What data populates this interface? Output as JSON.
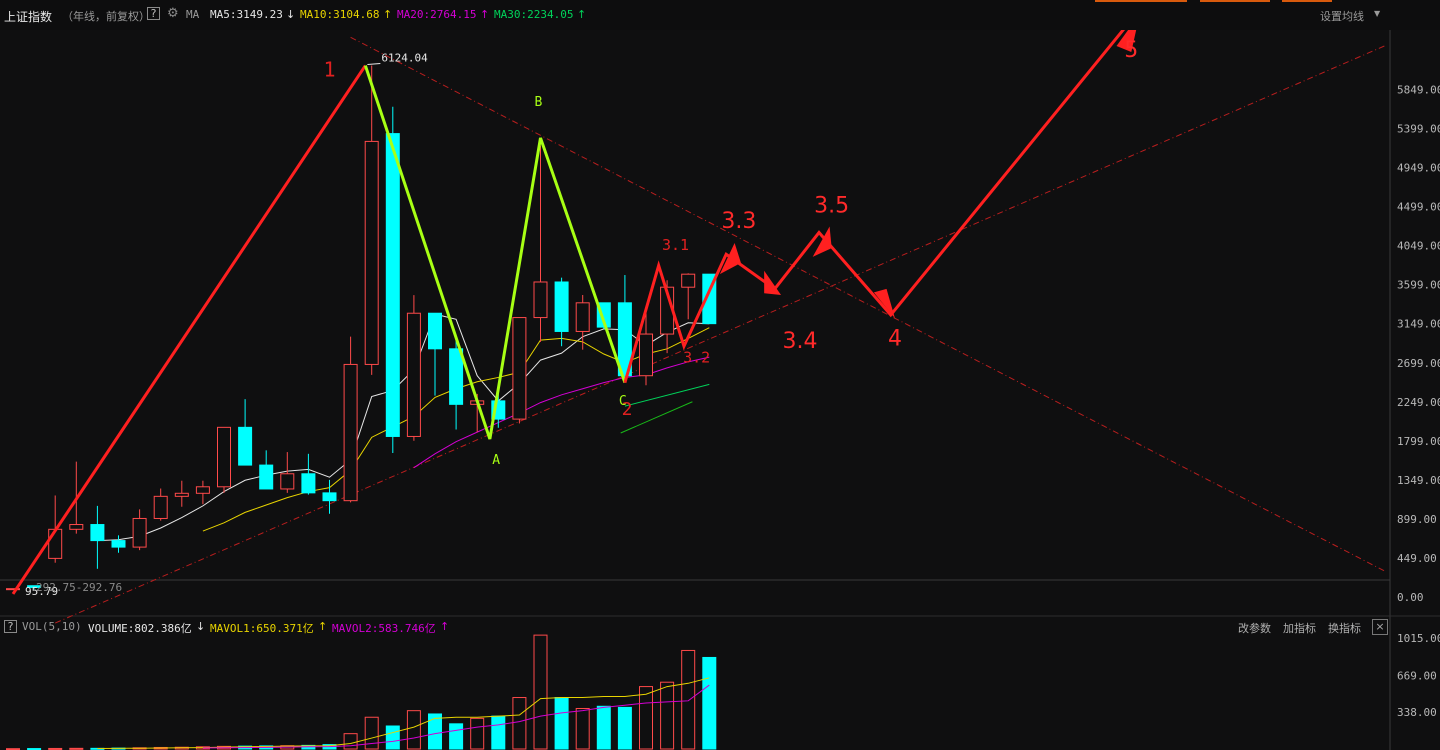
{
  "header": {
    "title": "上证指数",
    "subtitle": "（年线，前复权）",
    "help": "?",
    "gear_icon": "gear-icon",
    "ma_label": "MA",
    "ma5": "MA5:3149.23",
    "ma5_arrow": "↓",
    "ma10": "MA10:3104.68",
    "ma10_arrow": "↑",
    "ma20": "MA20:2764.15",
    "ma20_arrow": "↑",
    "ma30": "MA30:2234.05",
    "ma30_arrow": "↑",
    "settings": "设置均线",
    "colors": {
      "ma5": "#e6e6e6",
      "ma10": "#e8d400",
      "ma20": "#d400d4",
      "ma30": "#00d25a"
    }
  },
  "volume_panel": {
    "label": "VOL(5,10)",
    "volume": "VOLUME:802.386亿",
    "volume_arrow": "↓",
    "mavol1": "MAVOL1:650.371亿",
    "mavol1_arrow": "↑",
    "mavol2": "MAVOL2:583.746亿",
    "mavol2_arrow": "↑",
    "btn_change_params": "改参数",
    "btn_add_indicator": "加指标",
    "btn_switch_indicator": "换指标",
    "close": "×"
  },
  "chart_data": {
    "type": "candlestick",
    "price_axis": {
      "ticks": [
        "5849.00",
        "5399.00",
        "4949.00",
        "4499.00",
        "4049.00",
        "3599.00",
        "3149.00",
        "2699.00",
        "2249.00",
        "1799.00",
        "1349.00",
        "899.00",
        "449.00",
        "0.00"
      ],
      "ylim": [
        0,
        6400
      ]
    },
    "volume_axis": {
      "ticks": [
        "1015.00",
        "669.00",
        "338.00"
      ],
      "ylim": [
        0,
        1150
      ]
    },
    "candles": [
      {
        "o": 96,
        "h": 96,
        "l": 96,
        "c": 96,
        "v": 3
      },
      {
        "o": 130,
        "h": 130,
        "l": 95,
        "c": 110,
        "v": 4
      },
      {
        "o": 445,
        "h": 1170,
        "l": 395,
        "c": 780,
        "v": 5
      },
      {
        "o": 780,
        "h": 1560,
        "l": 730,
        "c": 835,
        "v": 6
      },
      {
        "o": 835,
        "h": 1050,
        "l": 325,
        "c": 650,
        "v": 6
      },
      {
        "o": 650,
        "h": 710,
        "l": 510,
        "c": 575,
        "v": 8
      },
      {
        "o": 575,
        "h": 1010,
        "l": 540,
        "c": 905,
        "v": 11
      },
      {
        "o": 905,
        "h": 1250,
        "l": 880,
        "c": 1160,
        "v": 14
      },
      {
        "o": 1160,
        "h": 1340,
        "l": 1040,
        "c": 1195,
        "v": 16
      },
      {
        "o": 1195,
        "h": 1340,
        "l": 1070,
        "c": 1270,
        "v": 20
      },
      {
        "o": 1270,
        "h": 1800,
        "l": 1200,
        "c": 1955,
        "v": 24
      },
      {
        "o": 1955,
        "h": 2280,
        "l": 1570,
        "c": 1520,
        "v": 26
      },
      {
        "o": 1520,
        "h": 1690,
        "l": 1380,
        "c": 1245,
        "v": 28
      },
      {
        "o": 1245,
        "h": 1670,
        "l": 1200,
        "c": 1420,
        "v": 30
      },
      {
        "o": 1420,
        "h": 1650,
        "l": 1180,
        "c": 1200,
        "v": 33
      },
      {
        "o": 1200,
        "h": 1350,
        "l": 960,
        "c": 1110,
        "v": 40
      },
      {
        "o": 1110,
        "h": 3000,
        "l": 1090,
        "c": 2680,
        "v": 140
      },
      {
        "o": 2680,
        "h": 6124,
        "l": 2560,
        "c": 5250,
        "v": 290
      },
      {
        "o": 5340,
        "h": 5650,
        "l": 1660,
        "c": 1850,
        "v": 210
      },
      {
        "o": 1850,
        "h": 3478,
        "l": 1800,
        "c": 3270,
        "v": 350
      },
      {
        "o": 3270,
        "h": 3260,
        "l": 2320,
        "c": 2860,
        "v": 320
      },
      {
        "o": 2860,
        "h": 3000,
        "l": 1930,
        "c": 2220,
        "v": 230
      },
      {
        "o": 2220,
        "h": 2340,
        "l": 1900,
        "c": 2260,
        "v": 280
      },
      {
        "o": 2260,
        "h": 2450,
        "l": 1950,
        "c": 2050,
        "v": 300
      },
      {
        "o": 2050,
        "h": 3200,
        "l": 2000,
        "c": 3220,
        "v": 470
      },
      {
        "o": 3220,
        "h": 5200,
        "l": 2940,
        "c": 3630,
        "v": 1040
      },
      {
        "o": 3630,
        "h": 3680,
        "l": 2890,
        "c": 3060,
        "v": 470
      },
      {
        "o": 3060,
        "h": 3480,
        "l": 2850,
        "c": 3390,
        "v": 370
      },
      {
        "o": 3390,
        "h": 3390,
        "l": 3090,
        "c": 3110,
        "v": 390
      },
      {
        "o": 3390,
        "h": 3710,
        "l": 2490,
        "c": 2550,
        "v": 380
      },
      {
        "o": 2550,
        "h": 3340,
        "l": 2440,
        "c": 3030,
        "v": 570
      },
      {
        "o": 3030,
        "h": 3650,
        "l": 2810,
        "c": 3570,
        "v": 610
      },
      {
        "o": 3570,
        "h": 3730,
        "l": 3200,
        "c": 3720,
        "v": 900
      },
      {
        "o": 3720,
        "h": 3720,
        "l": 3150,
        "c": 3150,
        "v": 836
      }
    ],
    "ma5": [
      null,
      null,
      null,
      null,
      650,
      660,
      700,
      795,
      915,
      1050,
      1215,
      1345,
      1405,
      1450,
      1470,
      1380,
      1580,
      2310,
      2380,
      2620,
      3260,
      3200,
      2550,
      2260,
      2460,
      2730,
      2810,
      3000,
      3090,
      3080,
      2900,
      3050,
      3160,
      3149
    ],
    "ma10": [
      null,
      null,
      null,
      null,
      null,
      null,
      null,
      null,
      null,
      760,
      855,
      975,
      1060,
      1145,
      1215,
      1260,
      1460,
      1840,
      1960,
      2080,
      2300,
      2400,
      2480,
      2530,
      2590,
      2960,
      2980,
      2940,
      2800,
      2700,
      2800,
      2860,
      2980,
      3104
    ],
    "ma20": [
      null,
      null,
      null,
      null,
      null,
      null,
      null,
      null,
      null,
      null,
      null,
      null,
      null,
      null,
      null,
      null,
      null,
      null,
      null,
      1490,
      1650,
      1790,
      1900,
      2010,
      2120,
      2240,
      2330,
      2400,
      2470,
      2530,
      2560,
      2640,
      2710,
      2764
    ],
    "ma30_segment": [
      {
        "i": 29,
        "v": 2200
      },
      {
        "i": 33,
        "v": 2450
      }
    ],
    "mavol1": [
      null,
      null,
      null,
      null,
      5,
      6,
      7,
      9,
      11,
      13,
      17,
      20,
      23,
      26,
      28,
      30,
      50,
      100,
      150,
      200,
      280,
      290,
      290,
      300,
      310,
      460,
      470,
      470,
      480,
      480,
      500,
      570,
      600,
      650
    ],
    "mavol2": [
      null,
      null,
      null,
      null,
      null,
      null,
      null,
      null,
      null,
      9,
      11,
      13,
      15,
      17,
      20,
      22,
      30,
      50,
      70,
      100,
      140,
      170,
      200,
      220,
      250,
      300,
      330,
      350,
      380,
      400,
      420,
      430,
      440,
      584
    ],
    "peak_label": "6124.04",
    "low_label": "95.79",
    "start_note": "292.75-292.76",
    "annotations": {
      "wave_labels": [
        "1",
        "2",
        "3.1",
        "3.2",
        "3.3",
        "3.4",
        "3.5",
        "4",
        "5"
      ],
      "abc_labels": [
        "A",
        "B",
        "C"
      ]
    }
  }
}
